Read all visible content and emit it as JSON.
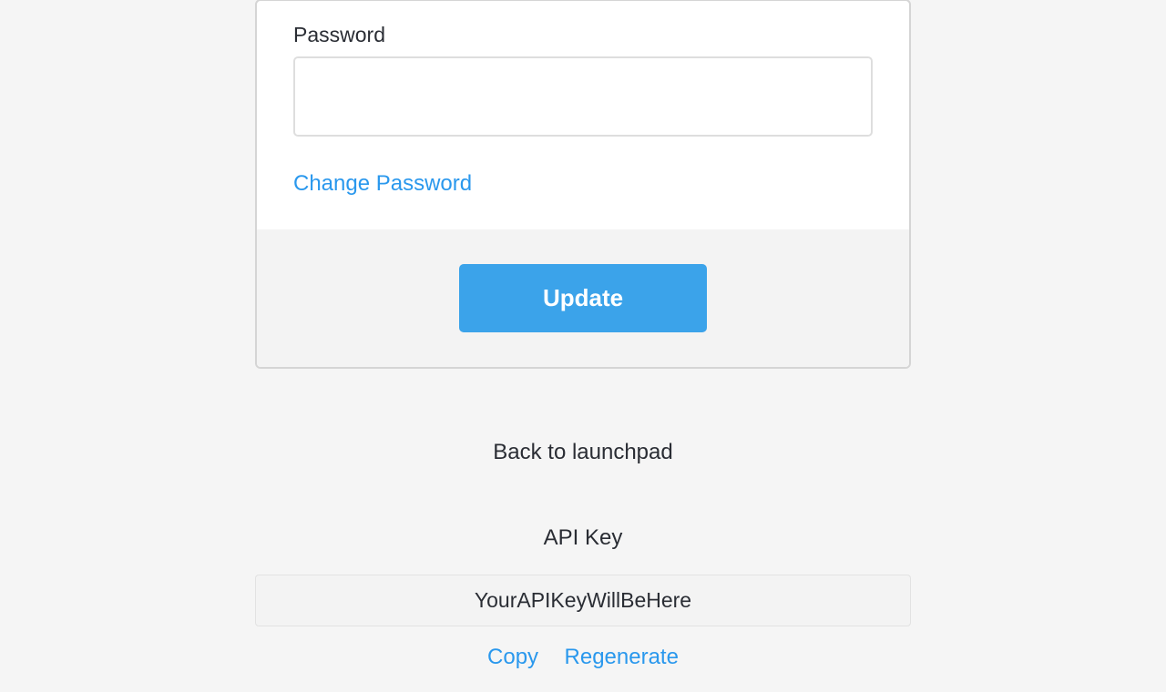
{
  "form": {
    "password_label": "Password",
    "password_value": "",
    "change_password_link": "Change Password",
    "update_button": "Update"
  },
  "nav": {
    "back_link": "Back to launchpad"
  },
  "api": {
    "heading": "API Key",
    "key_value": "YourAPIKeyWillBeHere",
    "copy_label": "Copy",
    "regenerate_label": "Regenerate"
  }
}
